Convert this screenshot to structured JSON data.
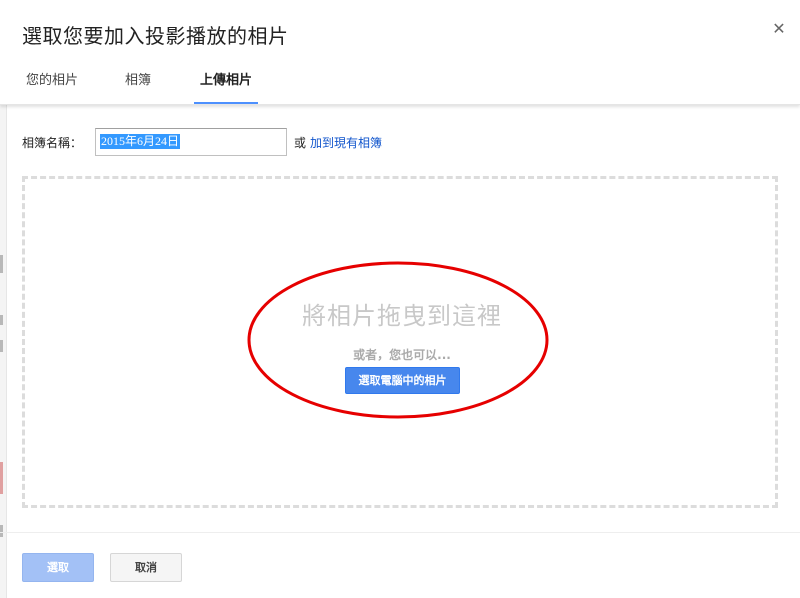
{
  "dialog": {
    "title": "選取您要加入投影播放的相片",
    "close_icon": "close-icon"
  },
  "tabs": [
    {
      "label": "您的相片",
      "active": false
    },
    {
      "label": "相簿",
      "active": false
    },
    {
      "label": "上傳相片",
      "active": true
    }
  ],
  "album": {
    "label": "相簿名稱：",
    "value": "2015年6月24日",
    "or_text": "或",
    "add_existing_link": "加到現有相簿"
  },
  "dropzone": {
    "title": "將相片拖曳到這裡",
    "subtitle": "或者，您也可以...",
    "choose_button": "選取電腦中的相片"
  },
  "footer": {
    "select_button": "選取",
    "cancel_button": "取消"
  },
  "colors": {
    "accent_blue": "#4787ed",
    "link_blue": "#1155cc",
    "disabled_blue": "#a3c1f6",
    "annotation_red": "#e60000",
    "dashed_border": "#dcdcdc"
  }
}
